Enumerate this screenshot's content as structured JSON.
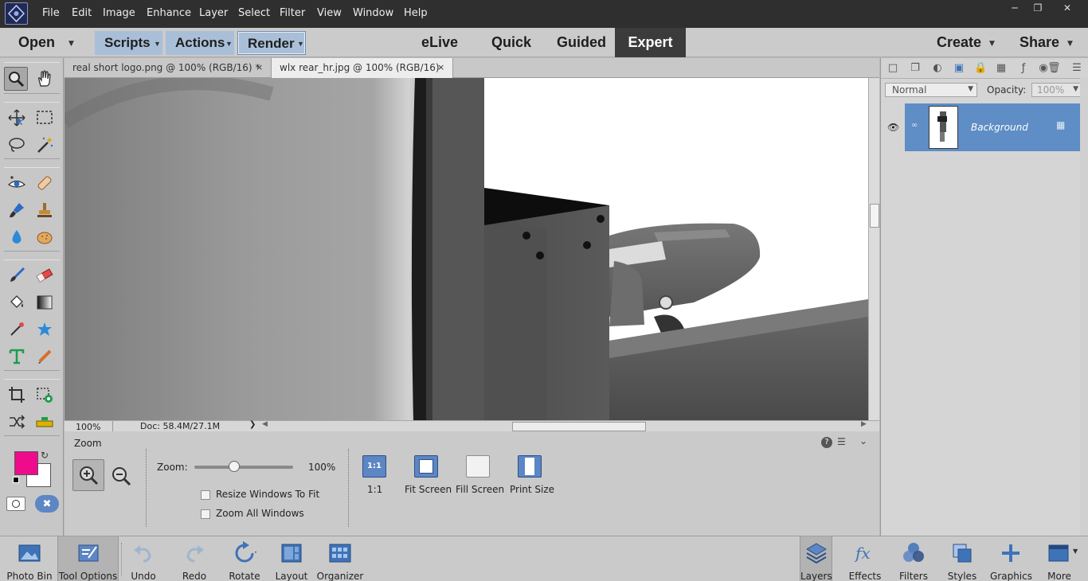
{
  "menubar": {
    "items": [
      "File",
      "Edit",
      "Image",
      "Enhance",
      "Layer",
      "Select",
      "Filter",
      "View",
      "Window",
      "Help"
    ]
  },
  "modebar": {
    "open": "Open",
    "scripts": "Scripts",
    "actions": "Actions",
    "render": "Render",
    "elive": "eLive",
    "quick": "Quick",
    "guided": "Guided",
    "expert": "Expert",
    "create": "Create",
    "share": "Share"
  },
  "tabs": [
    {
      "title": "real short logo.png @ 100% (RGB/16) *",
      "close": "×"
    },
    {
      "title": "wlx rear_hr.jpg @ 100% (RGB/16)",
      "close": "×"
    }
  ],
  "status": {
    "zoom": "100%",
    "doc": "Doc: 58.4M/27.1M"
  },
  "tool_options": {
    "tool_name": "Zoom",
    "zoom_label": "Zoom:",
    "zoom_value": "100%",
    "zoom_slider_level": 0.4,
    "resize_windows": "Resize Windows To Fit",
    "zoom_all": "Zoom All Windows",
    "btn_1to1_icon": "1:1",
    "btn_1to1": "1:1",
    "fit_screen": "Fit Screen",
    "fill_screen": "Fill Screen",
    "print_size": "Print Size",
    "help": "?"
  },
  "layers": {
    "blend_mode": "Normal",
    "opacity_label": "Opacity:",
    "opacity_value": "100%",
    "layer_name": "Background"
  },
  "colors": {
    "foreground": "#ee0c8c",
    "background": "#ffffff",
    "accent": "#5f8dc5"
  },
  "bottombar": {
    "photo_bin": "Photo Bin",
    "tool_options": "Tool Options",
    "undo": "Undo",
    "redo": "Redo",
    "rotate": "Rotate",
    "layout": "Layout",
    "organizer": "Organizer",
    "layers": "Layers",
    "effects": "Effects",
    "filters": "Filters",
    "styles": "Styles",
    "graphics": "Graphics",
    "more": "More"
  }
}
